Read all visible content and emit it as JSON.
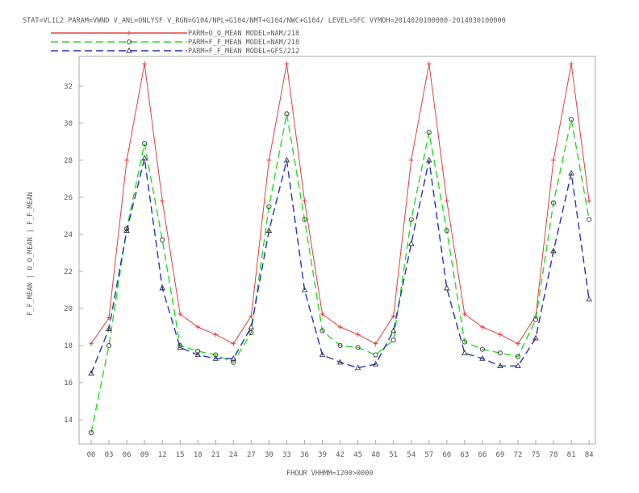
{
  "chart_data": {
    "type": "line",
    "title": "STAT=VL1L2 PARAM=VWND V_ANL=ONLYSF V_RGN=G104/NPL+G104/NMT+G104/NWC+G104/ LEVEL=SFC VYMDH=2014020100000-2014030100000",
    "xlabel": "FHOUR VHHMM=1200>0000",
    "ylabel": "F_F_MEAN | O_O_MEAN | F_F_MEAN",
    "categories": [
      "00",
      "03",
      "06",
      "09",
      "12",
      "15",
      "18",
      "21",
      "24",
      "27",
      "30",
      "33",
      "36",
      "39",
      "42",
      "45",
      "48",
      "51",
      "54",
      "57",
      "60",
      "63",
      "66",
      "69",
      "72",
      "75",
      "78",
      "81",
      "84"
    ],
    "yticks": [
      14,
      16,
      18,
      20,
      22,
      24,
      26,
      28,
      30,
      32
    ],
    "ylim": [
      12.7,
      33.6
    ],
    "grid": false,
    "legend_position": "top-left",
    "series": [
      {
        "name": "PARM=O_O_MEAN MODEL=NAM/218",
        "color": "#e04040",
        "dash": "solid",
        "marker": "plus",
        "values": [
          18.1,
          19.5,
          28.0,
          33.2,
          25.8,
          19.7,
          19.0,
          18.6,
          18.1,
          19.6,
          28.0,
          33.2,
          25.8,
          19.7,
          19.0,
          18.6,
          18.1,
          19.6,
          28.0,
          33.2,
          25.8,
          19.7,
          19.0,
          18.6,
          18.1,
          19.6,
          28.0,
          33.2,
          25.8
        ]
      },
      {
        "name": "PARM=F_F_MEAN MODEL=NAM/218",
        "color": "#22dd22",
        "dash": "long",
        "marker": "circle",
        "values": [
          13.3,
          18.0,
          24.3,
          28.9,
          23.7,
          18.0,
          17.7,
          17.5,
          17.1,
          18.7,
          25.5,
          30.5,
          24.8,
          18.8,
          18.0,
          17.9,
          17.5,
          18.3,
          24.8,
          29.5,
          24.2,
          18.2,
          17.8,
          17.6,
          17.4,
          19.4,
          25.7,
          30.2,
          24.8
        ]
      },
      {
        "name": "PARM=F_F_MEAN MODEL=GFS/212",
        "color": "#2233bb",
        "dash": "long",
        "marker": "triangle",
        "values": [
          16.5,
          18.9,
          24.2,
          28.1,
          21.1,
          17.9,
          17.5,
          17.3,
          17.3,
          19.0,
          24.2,
          28.0,
          21.0,
          17.5,
          17.1,
          16.8,
          17.0,
          18.8,
          23.5,
          28.0,
          21.1,
          17.6,
          17.3,
          16.9,
          16.9,
          18.4,
          23.1,
          27.3,
          20.5
        ]
      }
    ]
  }
}
